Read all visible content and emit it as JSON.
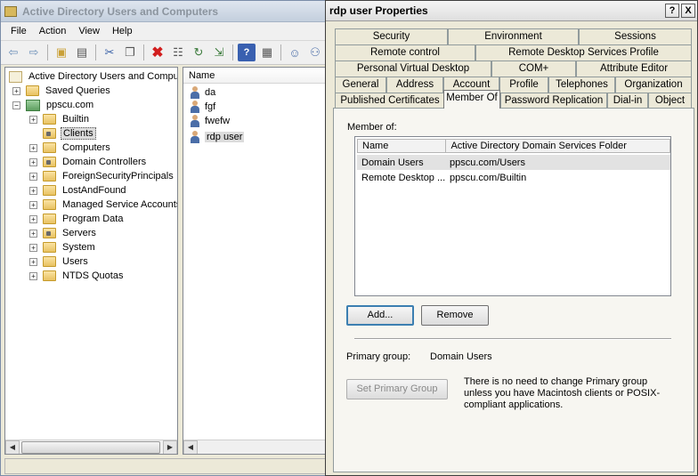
{
  "aduc": {
    "title": "Active Directory Users and Computers",
    "menu": [
      "File",
      "Action",
      "View",
      "Help"
    ],
    "tree": {
      "root": "Active Directory Users and Comput",
      "saved_queries": "Saved Queries",
      "domain": "ppscu.com",
      "children": [
        "Builtin",
        "Clients",
        "Computers",
        "Domain Controllers",
        "ForeignSecurityPrincipals",
        "LostAndFound",
        "Managed Service Accounts",
        "Program Data",
        "Servers",
        "System",
        "Users",
        "NTDS Quotas"
      ],
      "selected": "Clients"
    },
    "list": {
      "column": "Name",
      "items": [
        "da",
        "fgf",
        "fwefw",
        "rdp user"
      ],
      "selected": "rdp user"
    }
  },
  "dialog": {
    "title": "rdp user Properties",
    "title_buttons": {
      "help": "?",
      "close": "X"
    },
    "tabs": {
      "row1": [
        "Security",
        "Environment",
        "Sessions"
      ],
      "row2": [
        "Remote control",
        "Remote Desktop Services Profile"
      ],
      "row3": [
        "Personal Virtual Desktop",
        "COM+",
        "Attribute Editor"
      ],
      "row4": [
        "General",
        "Address",
        "Account",
        "Profile",
        "Telephones",
        "Organization"
      ],
      "row5": [
        "Published Certificates",
        "Member Of",
        "Password Replication",
        "Dial-in",
        "Object"
      ],
      "active": "Member Of"
    },
    "member_of_label": "Member of:",
    "grid": {
      "headers": [
        "Name",
        "Active Directory Domain Services Folder"
      ],
      "rows": [
        {
          "name": "Domain Users",
          "folder": "ppscu.com/Users"
        },
        {
          "name": "Remote Desktop ...",
          "folder": "ppscu.com/Builtin"
        }
      ]
    },
    "add_button": "Add...",
    "remove_button": "Remove",
    "primary_group_label": "Primary group:",
    "primary_group_value": "Domain Users",
    "set_primary_button": "Set Primary Group",
    "info_text": "There is no need to change Primary group unless you have Macintosh clients or POSIX-compliant applications."
  }
}
